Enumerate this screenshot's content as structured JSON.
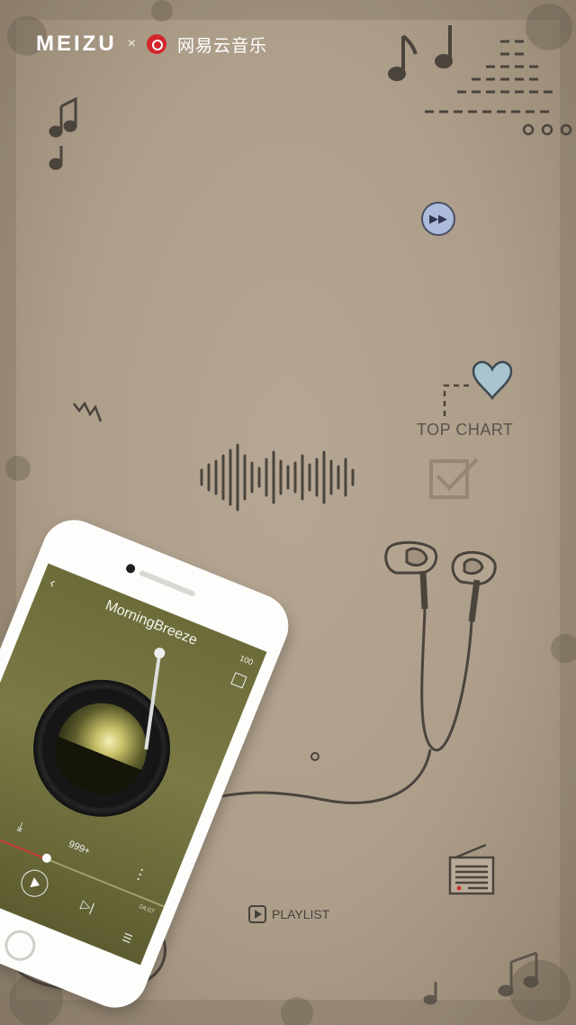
{
  "header": {
    "brand_left": "MEIZU",
    "separator": "×",
    "brand_right": "网易云音乐"
  },
  "labels": {
    "top_chart": "TOP CHART",
    "playlist": "PLAYLIST"
  },
  "icons": {
    "fast_forward": "fast-forward-icon",
    "heart": "heart-icon",
    "checkbox": "checkbox-icon",
    "headphones": "earphones-icon",
    "radio": "radio-icon",
    "waveform": "waveform-icon",
    "equalizer": "equalizer-icon",
    "music_notes": "music-note-icon"
  },
  "phone": {
    "song_title": "MorningBreeze",
    "battery": "100",
    "comments_count": "999+",
    "elapsed": "",
    "duration": "04:07",
    "progress": 0.46
  },
  "colors": {
    "background": "#ad9e8a",
    "heart": "#a7c4cf",
    "ff_button": "#aebcdb",
    "netease_red": "#d4262c"
  }
}
